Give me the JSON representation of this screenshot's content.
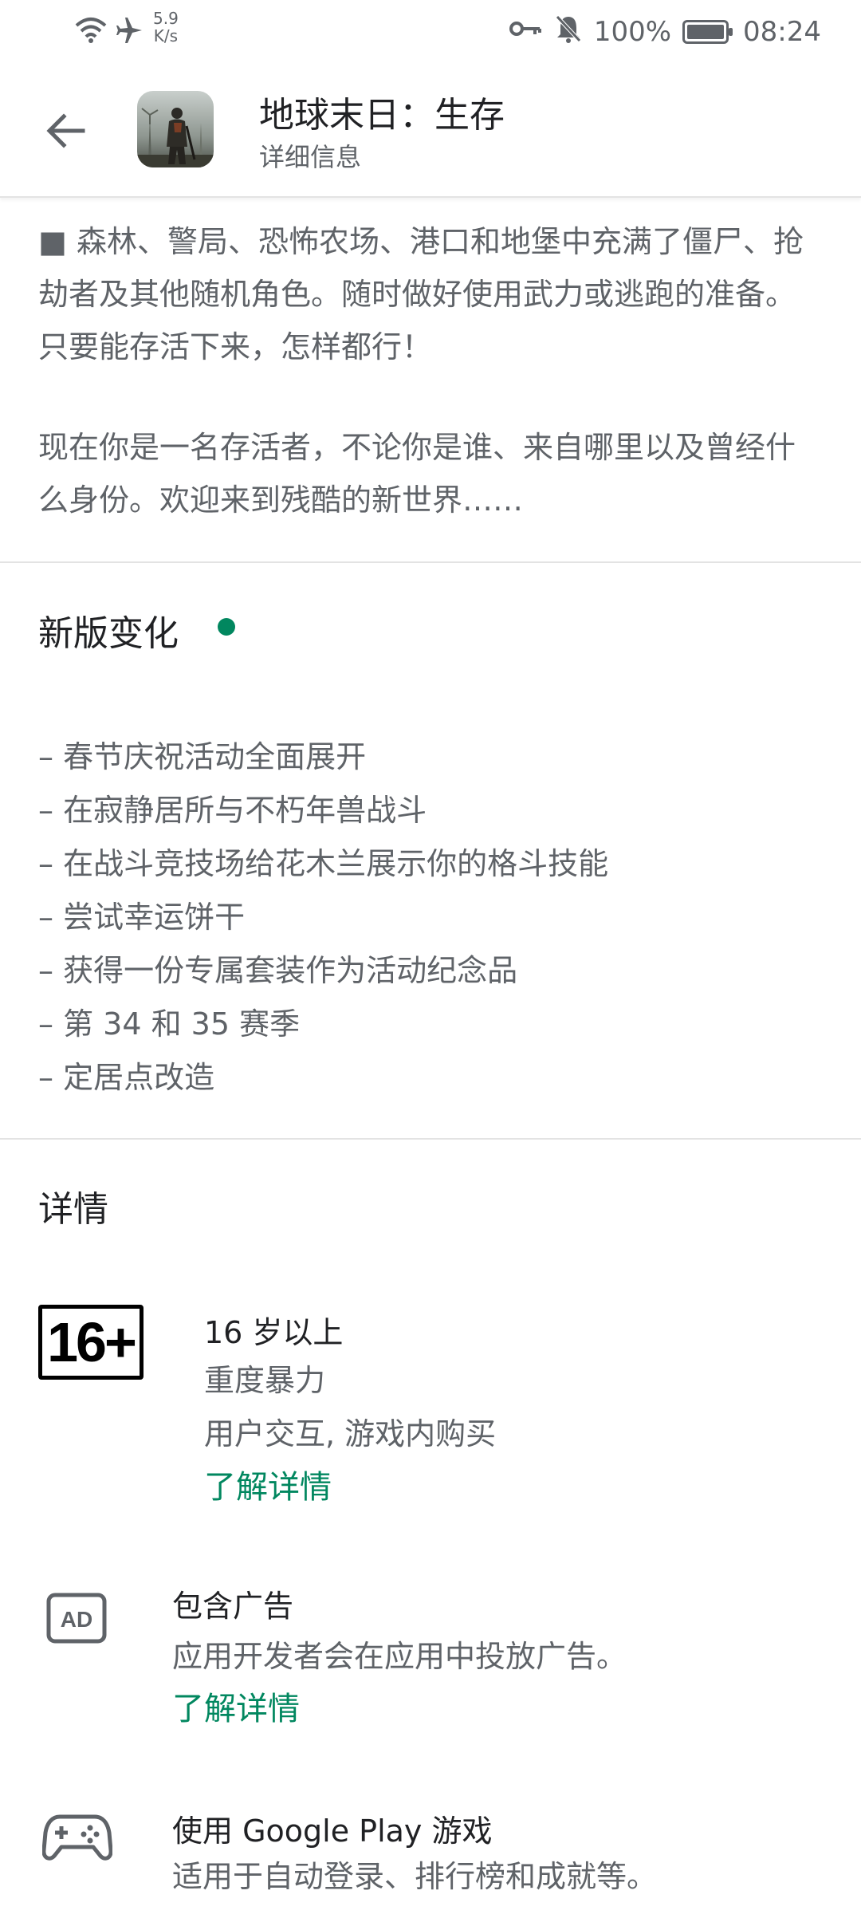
{
  "status_bar": {
    "speed_value": "5.9",
    "speed_unit": "K/s",
    "battery": "100%",
    "time": "08:24"
  },
  "header": {
    "title": "地球末日：生存",
    "subtitle": "详细信息"
  },
  "description": {
    "paragraph1": "■ 森林、警局、恐怖农场、港口和地堡中充满了僵尸、抢劫者及其他随机角色。随时做好使用武力或逃跑的准备。只要能存活下来，怎样都行！",
    "paragraph2": "现在你是一名存活者，不论你是谁、来自哪里以及曾经什么身份。欢迎来到残酷的新世界……"
  },
  "whats_new": {
    "title": "新版变化",
    "items": [
      "– 春节庆祝活动全面展开",
      "– 在寂静居所与不朽年兽战斗",
      "– 在战斗竞技场给花木兰展示你的格斗技能",
      "– 尝试幸运饼干",
      "– 获得一份专属套装作为活动纪念品",
      "– 第 34 和 35 赛季",
      "– 定居点改造"
    ]
  },
  "details": {
    "title": "详情",
    "rating": {
      "badge": "16+",
      "title": "16 岁以上",
      "line1": "重度暴力",
      "line2": "用户交互, 游戏内购买",
      "link": "了解详情"
    },
    "ads": {
      "icon_text": "AD",
      "title": "包含广告",
      "line1": "应用开发者会在应用中投放广告。",
      "link": "了解详情"
    },
    "games": {
      "title": "使用 Google Play 游戏",
      "line1": "适用于自动登录、排行榜和成就等。"
    }
  },
  "colors": {
    "accent": "#01875f",
    "text_primary": "#202124",
    "text_secondary": "#5f6368"
  }
}
